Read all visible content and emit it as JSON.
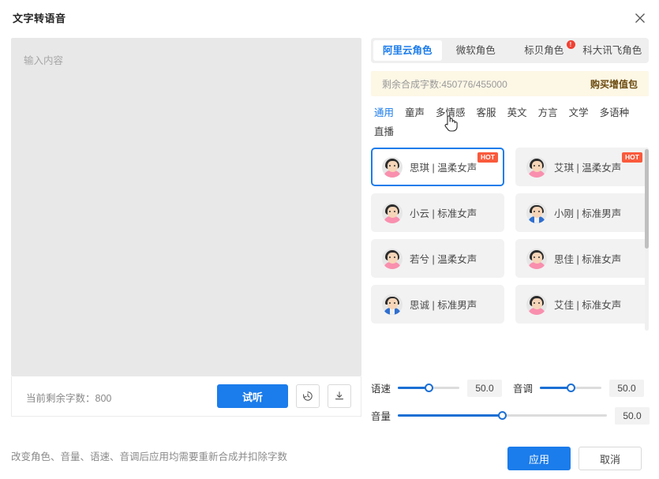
{
  "dialog": {
    "title": "文字转语音",
    "close_icon": "close-icon"
  },
  "editor": {
    "placeholder": "输入内容",
    "value": "",
    "remaining_label": "当前剩余字数：800",
    "audition_label": "试听",
    "history_icon": "history-icon",
    "download_icon": "download-icon"
  },
  "hint": "改变角色、音量、语速、音调后应用均需要重新合成并扣除字数",
  "providers": [
    {
      "label": "阿里云角色",
      "active": true,
      "badge": ""
    },
    {
      "label": "微软角色",
      "active": false,
      "badge": ""
    },
    {
      "label": "标贝角色",
      "active": false,
      "badge": "!"
    },
    {
      "label": "科大讯飞角色",
      "active": false,
      "badge": ""
    }
  ],
  "notice": {
    "text": "剩余合成字数:450776/455000",
    "link": "购买增值包"
  },
  "categories": [
    {
      "label": "通用",
      "active": true
    },
    {
      "label": "童声",
      "active": false
    },
    {
      "label": "多情感",
      "active": false
    },
    {
      "label": "客服",
      "active": false
    },
    {
      "label": "英文",
      "active": false
    },
    {
      "label": "方言",
      "active": false
    },
    {
      "label": "文学",
      "active": false
    },
    {
      "label": "多语种",
      "active": false
    },
    {
      "label": "直播",
      "active": false
    }
  ],
  "voices": [
    {
      "name": "思琪 | 温柔女声",
      "gender": "female",
      "selected": true,
      "badge": "HOT"
    },
    {
      "name": "艾琪 | 温柔女声",
      "gender": "female",
      "selected": false,
      "badge": "HOT"
    },
    {
      "name": "小云 | 标准女声",
      "gender": "female",
      "selected": false,
      "badge": ""
    },
    {
      "name": "小刚 | 标准男声",
      "gender": "male",
      "selected": false,
      "badge": ""
    },
    {
      "name": "若兮 | 温柔女声",
      "gender": "female",
      "selected": false,
      "badge": ""
    },
    {
      "name": "思佳 | 标准女声",
      "gender": "female",
      "selected": false,
      "badge": ""
    },
    {
      "name": "思诚 | 标准男声",
      "gender": "male",
      "selected": false,
      "badge": ""
    },
    {
      "name": "艾佳 | 标准女声",
      "gender": "female",
      "selected": false,
      "badge": ""
    }
  ],
  "sliders": [
    {
      "label": "语速",
      "value": "50.0",
      "percent": 50
    },
    {
      "label": "音调",
      "value": "50.0",
      "percent": 50
    },
    {
      "label": "音量",
      "value": "50.0",
      "percent": 50
    }
  ],
  "footer": {
    "apply_label": "应用",
    "cancel_label": "取消"
  },
  "colors": {
    "primary": "#1b7ceb",
    "hot": "#fa5a3c",
    "badge": "#f04134",
    "notice_bg": "#fdf7e6",
    "notice_link": "#6b4b10"
  }
}
